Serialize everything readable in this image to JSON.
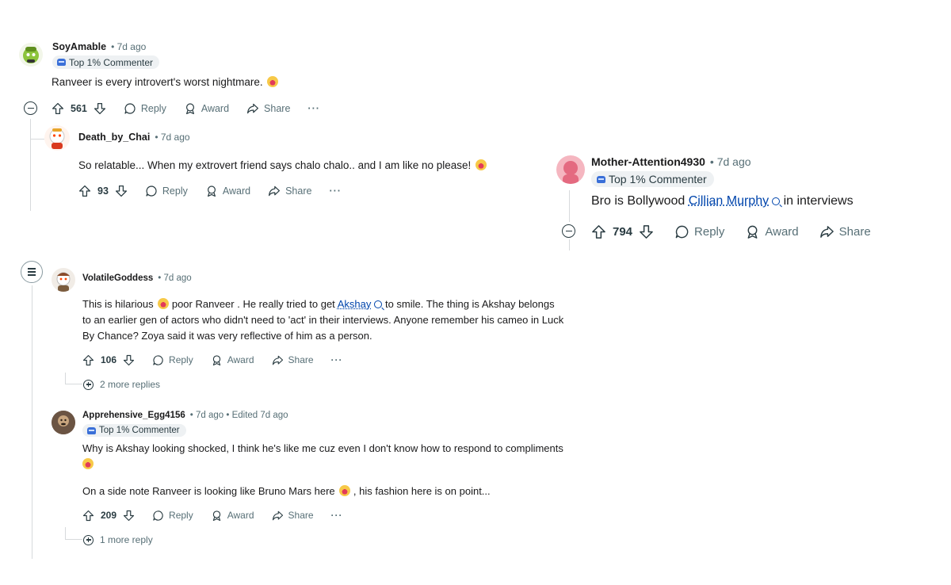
{
  "comments": {
    "c1": {
      "username": "SoyAmable",
      "time": "• 7d ago",
      "badge": "Top 1% Commenter",
      "text": "Ranveer is every introvert's worst nightmare.",
      "votes": "561",
      "reply": "Reply",
      "award": "Award",
      "share": "Share",
      "more": "···"
    },
    "c2": {
      "username": "Death_by_Chai",
      "time": "• 7d ago",
      "text": "So relatable... When my extrovert friend says chalo chalo.. and I am like no please!",
      "votes": "93",
      "reply": "Reply",
      "award": "Award",
      "share": "Share",
      "more": "···"
    },
    "c3": {
      "username": "Mother-Attention4930",
      "time": "• 7d ago",
      "badge": "Top 1% Commenter",
      "text_before": "Bro is Bollywood",
      "link": "Cillian Murphy",
      "text_after": "in interviews",
      "votes": "794",
      "reply": "Reply",
      "award": "Award",
      "share": "Share"
    },
    "c4": {
      "username": "VolatileGoddess",
      "time": "• 7d ago",
      "text_line1_before": "This is hilarious",
      "text_line1_mid": "poor Ranveer . He really tried to get",
      "link": "Akshay",
      "text_line1_after": "to smile. The thing is Akshay belongs",
      "text_line2": "to an earlier gen of actors who didn't need to 'act' in their interviews. Anyone remember his cameo in Luck",
      "text_line3": "By Chance? Zoya said it was very reflective of him as a person.",
      "votes": "106",
      "reply": "Reply",
      "award": "Award",
      "share": "Share",
      "more": "···",
      "more_replies": "2 more replies"
    },
    "c5": {
      "username": "Apprehensive_Egg4156",
      "time": "• 7d ago • Edited 7d ago",
      "badge": "Top 1% Commenter",
      "text_line1": "Why is Akshay looking shocked, I think he's like me cuz even I don't know how to respond to compliments",
      "text_line2_before": "On a side note Ranveer is looking like Bruno Mars here",
      "text_line2_after": ", his fashion here is on point...",
      "votes": "209",
      "reply": "Reply",
      "award": "Award",
      "share": "Share",
      "more": "···",
      "more_replies": "1 more reply"
    }
  },
  "icons": {
    "upvote": "upvote-arrow-icon",
    "downvote": "downvote-arrow-icon",
    "reply": "speech-bubble-icon",
    "award": "award-ribbon-icon",
    "share": "share-arrow-icon",
    "collapse": "collapse-minus-icon",
    "expand": "expand-plus-icon",
    "menu": "menu-lines-icon",
    "search": "search-icon"
  },
  "colors": {
    "accent_link": "#0045ac",
    "badge_bg": "#eef1f3",
    "meta_text": "#576f76"
  }
}
